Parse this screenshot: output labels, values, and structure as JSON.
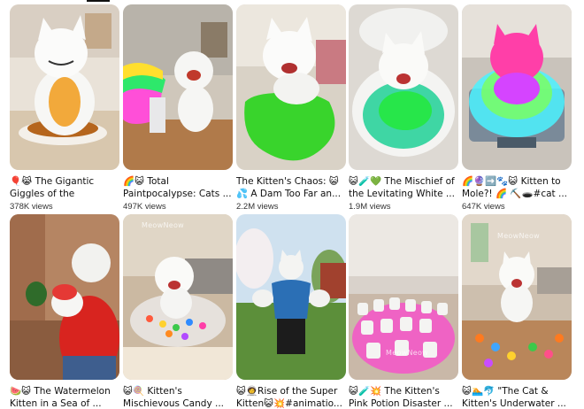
{
  "videos": [
    {
      "title": "🎈😹 The Gigantic Giggles of the Inflated...",
      "views": "378K views"
    },
    {
      "title": "🌈😺 Total Paintpocalypse: Cats ...",
      "views": "497K views"
    },
    {
      "title": "The Kitten's Chaos: 😺 💦 A Dam Too Far an...",
      "views": "2.2M views"
    },
    {
      "title": "😺🧪💚 The Mischief of the Levitating White ...",
      "views": "1.9M views"
    },
    {
      "title": "🌈🔮➡️🐾😺 Kitten to Mole?! 🌈 ⛏️🕳️#cat ...",
      "views": "647K views"
    },
    {
      "title": "🍉😺 The Watermelon Kitten in a Sea of ...",
      "views": ""
    },
    {
      "title": "😺🍭 Kitten's Mischievous Candy ...",
      "views": ""
    },
    {
      "title": "😺🧑‍🚀Rise of the Super Kitten😺💥#animatio...",
      "views": ""
    },
    {
      "title": "😺🧪💥 The Kitten's Pink Potion Disaster ...",
      "views": ""
    },
    {
      "title": "😺🏊🐬 \"The Cat & Kitten's Underwater ...",
      "views": ""
    }
  ],
  "watermarks": {
    "v6": "MeowNeow",
    "v9": "MeowNeow",
    "v10": "MeowNeow"
  },
  "colors": {
    "text": "#0f0f0f",
    "meta": "#606060",
    "background": "#ffffff"
  }
}
